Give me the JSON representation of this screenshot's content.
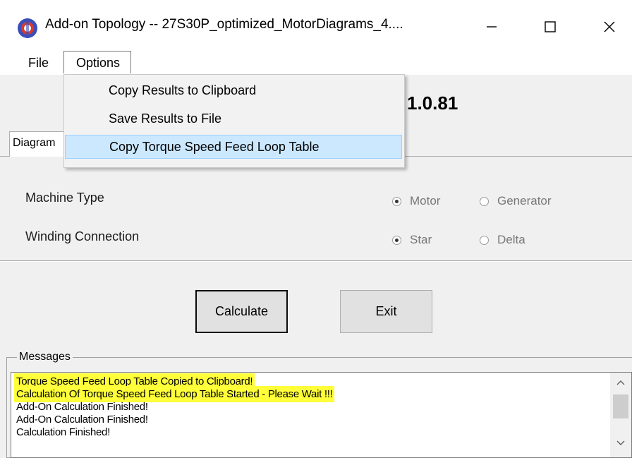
{
  "window": {
    "title": "Add-on Topology -- 27S30P_optimized_MotorDiagrams_4....",
    "icons": {
      "app": "app-icon",
      "minimize": "minimize-icon",
      "maximize": "maximize-icon",
      "close": "close-icon"
    }
  },
  "menubar": {
    "file_label": "File",
    "options_label": "Options"
  },
  "options_menu": {
    "items": [
      {
        "label": "Copy Results to Clipboard"
      },
      {
        "label": "Save Results to File"
      },
      {
        "label": "Copy Torque Speed Feed Loop Table",
        "highlighted": true
      }
    ]
  },
  "version": "1.0.81",
  "tab": {
    "label": "Diagram"
  },
  "form": {
    "machine_type": {
      "label": "Machine Type",
      "options": [
        {
          "label": "Motor",
          "selected": true
        },
        {
          "label": "Generator",
          "selected": false
        }
      ]
    },
    "winding_connection": {
      "label": "Winding Connection",
      "options": [
        {
          "label": "Star",
          "selected": true
        },
        {
          "label": "Delta",
          "selected": false
        }
      ]
    }
  },
  "buttons": {
    "calculate": "Calculate",
    "exit": "Exit"
  },
  "messages": {
    "label": "Messages",
    "lines": [
      {
        "text": "Torque Speed Feed Loop Table Copied to Clipboard!",
        "highlighted": true
      },
      {
        "text": "Calculation Of Torque Speed Feed Loop Table Started - Please Wait !!!",
        "highlighted": true
      },
      {
        "text": "Add-On Calculation Finished!",
        "highlighted": false
      },
      {
        "text": "Add-On Calculation Finished!",
        "highlighted": false
      },
      {
        "text": "Calculation Finished!",
        "highlighted": false
      },
      {
        "text": "",
        "highlighted": false
      }
    ]
  },
  "colors": {
    "highlight": "#ffff3a",
    "menu_selection": "#cce8ff"
  }
}
